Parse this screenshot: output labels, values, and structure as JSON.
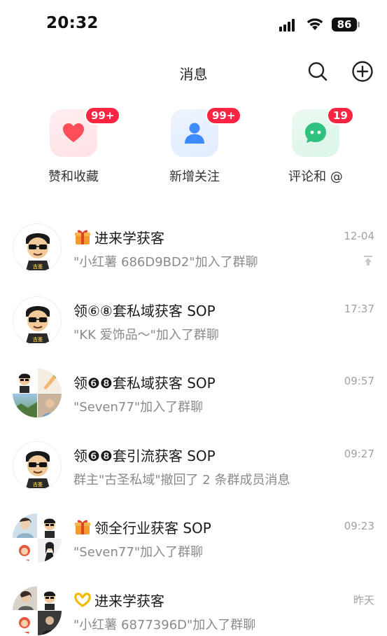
{
  "status_bar": {
    "time": "20:32",
    "battery": "86"
  },
  "header": {
    "title": "消息"
  },
  "shortcuts": [
    {
      "label": "赞和收藏",
      "badge": "99+",
      "icon": "heart-icon",
      "bg": "#ffe8ea",
      "color": "#ff4d5a"
    },
    {
      "label": "新增关注",
      "badge": "99+",
      "icon": "person-icon",
      "bg": "#e6f0ff",
      "color": "#3d8bff"
    },
    {
      "label": "评论和 @",
      "badge": "19",
      "icon": "chat-bubble-icon",
      "bg": "#e4f8ee",
      "color": "#2ec27e"
    }
  ],
  "conversations": [
    {
      "title": "进来学获客",
      "emoji": "gift-icon",
      "subtitle": "\"小红薯 686D9BD2\"加入了群聊",
      "time": "12-04",
      "pinned": true
    },
    {
      "title": "领⑥⑧套私域获客 SOP",
      "subtitle": "\"KK 爱饰品～\"加入了群聊",
      "time": "17:37"
    },
    {
      "title": "领❻❽套私域获客 SOP",
      "subtitle": "\"Seven77\"加入了群聊",
      "time": "09:57"
    },
    {
      "title": "领❻❽套引流获客 SOP",
      "subtitle": "群主\"古圣私域\"撤回了 2 条群成员消息",
      "time": "09:27"
    },
    {
      "title": "领全行业获客 SOP",
      "emoji": "gift-icon",
      "subtitle": "\"Seven77\"加入了群聊",
      "time": "09:23"
    },
    {
      "title": "进来学获客",
      "emoji": "heart-hands-icon",
      "subtitle": "\"小红薯 6877396D\"加入了群聊",
      "time": "昨天"
    }
  ]
}
